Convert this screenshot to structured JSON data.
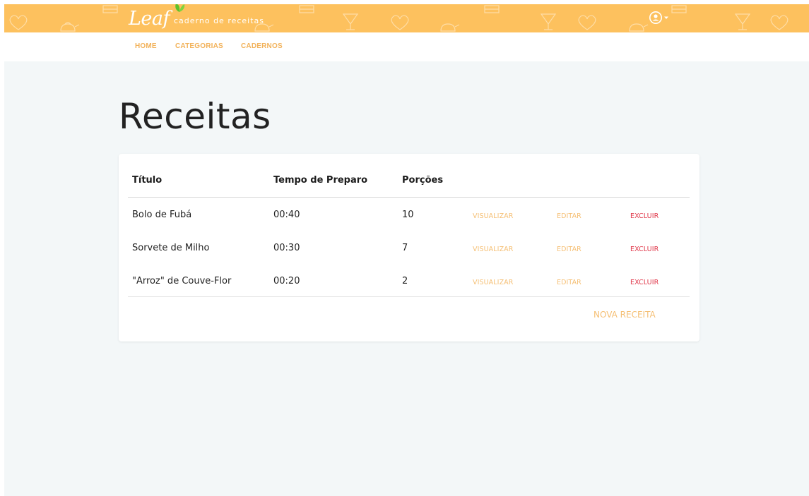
{
  "colors": {
    "header_background": "#fdc15e",
    "accent": "#f2b25a",
    "action_link": "#f5bf74",
    "danger": "#e0384a",
    "page_background": "#f3f7f8"
  },
  "header": {
    "logo_text": "Leaf",
    "tagline": "caderno de receitas",
    "logo_icon": "leaf-icon",
    "user_icon": "user-circle-icon",
    "user_menu_caret_icon": "caret-down-icon",
    "pattern_icons": [
      "heart-icon",
      "teapot-icon",
      "cocktail-glass-icon",
      "cake-icon"
    ]
  },
  "nav": {
    "items": [
      {
        "label": "HOME"
      },
      {
        "label": "CATEGORIAS"
      },
      {
        "label": "CADERNOS"
      }
    ]
  },
  "page": {
    "title": "Receitas"
  },
  "table": {
    "columns": [
      "Título",
      "Tempo de Preparo",
      "Porções"
    ],
    "actions": {
      "view": "VISUALIZAR",
      "edit": "EDITAR",
      "delete": "EXCLUIR"
    },
    "rows": [
      {
        "title": "Bolo de Fubá",
        "time": "00:40",
        "portions": "10"
      },
      {
        "title": "Sorvete de Milho",
        "time": "00:30",
        "portions": "7"
      },
      {
        "title": "\"Arroz\" de Couve-Flor",
        "time": "00:20",
        "portions": "2"
      }
    ],
    "new_button": "NOVA RECEITA"
  }
}
